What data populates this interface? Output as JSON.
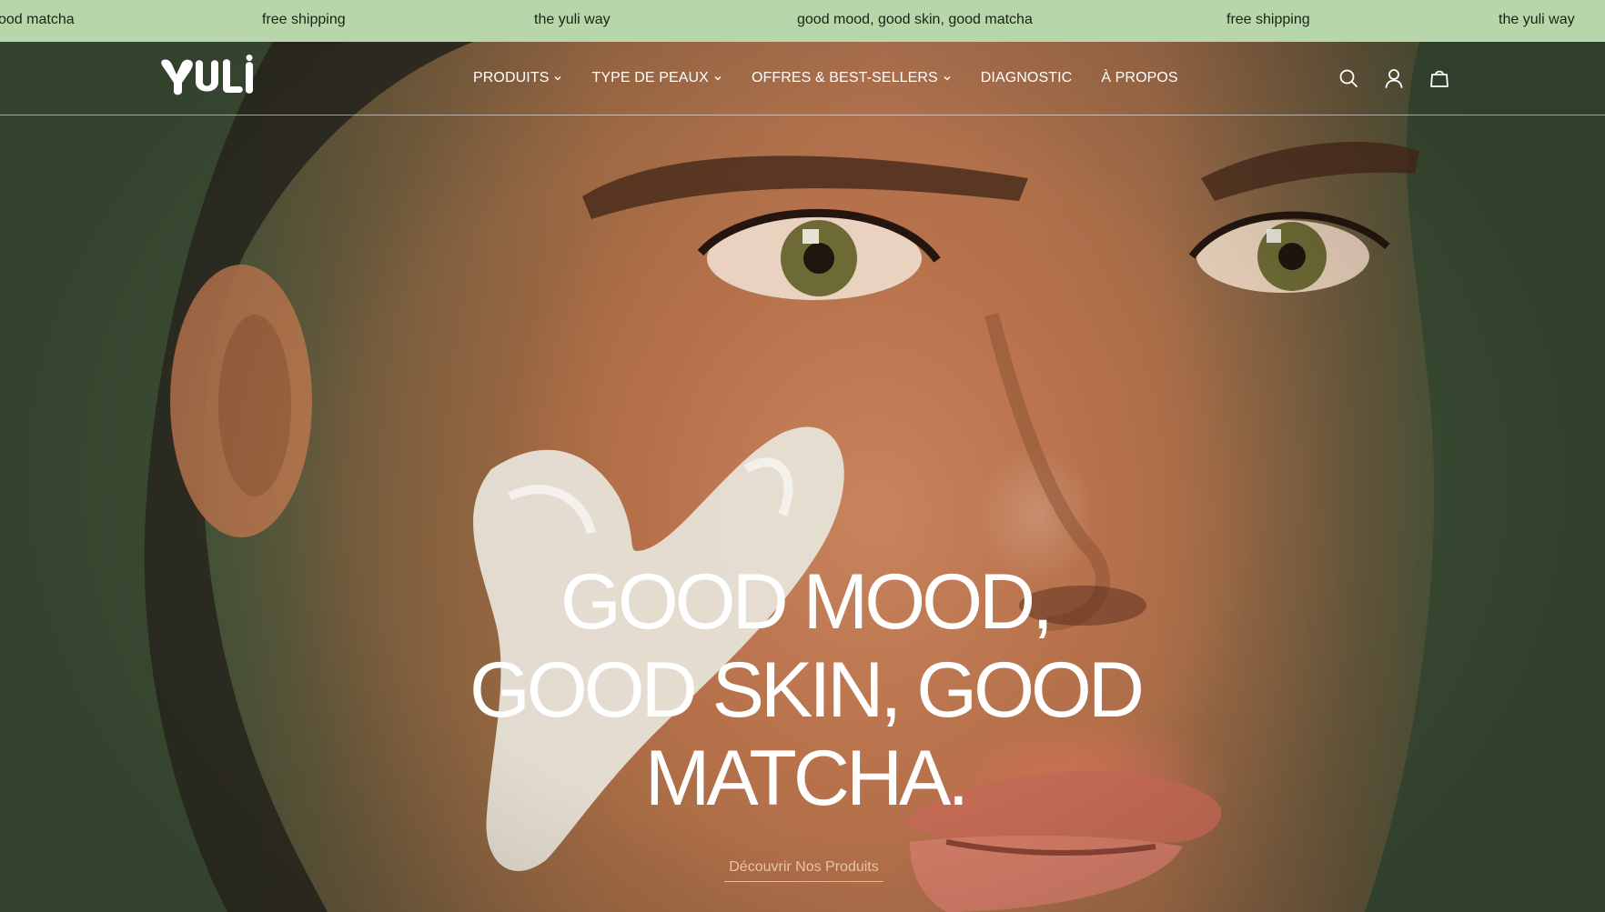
{
  "announcement_bar": {
    "items": [
      "ood matcha",
      "free shipping",
      "the yuli way",
      "good mood, good skin, good matcha",
      "free shipping",
      "the yuli way"
    ],
    "background_color": "#b7d7ab"
  },
  "header": {
    "logo_text": "YULI",
    "nav": [
      {
        "label": "PRODUITS",
        "has_dropdown": true
      },
      {
        "label": "TYPE DE PEAUX",
        "has_dropdown": true
      },
      {
        "label": "OFFRES & BEST-SELLERS",
        "has_dropdown": true
      },
      {
        "label": "DIAGNOSTIC",
        "has_dropdown": false
      },
      {
        "label": "À PROPOS",
        "has_dropdown": false
      }
    ],
    "icons": [
      "search-icon",
      "account-icon",
      "cart-icon"
    ]
  },
  "hero": {
    "headline_lines": [
      "GOOD MOOD,",
      "GOOD SKIN, GOOD",
      "MATCHA."
    ],
    "cta_label": "Découvrir Nos Produits"
  }
}
